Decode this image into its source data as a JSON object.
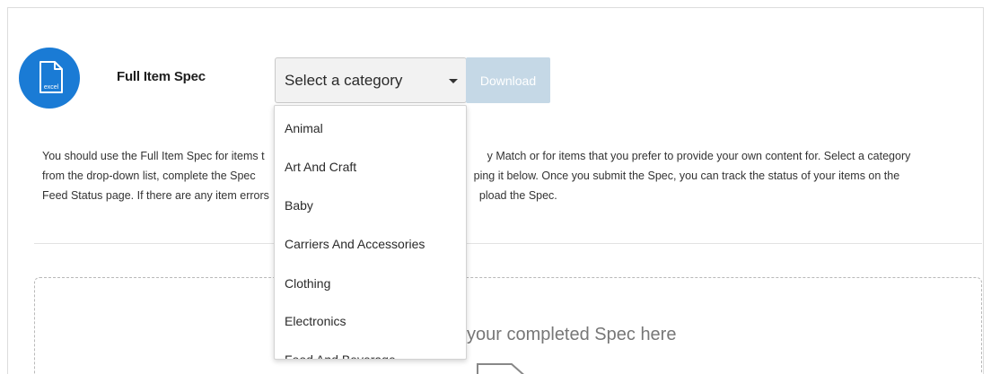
{
  "spec": {
    "title": "Full Item Spec",
    "icon": "excel-file-icon",
    "icon_text": "excel",
    "accent_color": "#1a7bd5"
  },
  "category_select": {
    "selected": "Select a category",
    "options": [
      "Animal",
      "Art And Craft",
      "Baby",
      "Carriers And Accessories",
      "Clothing",
      "Electronics",
      "Food And Beverage"
    ]
  },
  "download": {
    "label": "Download",
    "color": "#c5d8e6"
  },
  "description": {
    "line1": "You should use the Full Item Spec for items t",
    "line1b": "y Match or for items that you prefer to provide your own content for. Select a category",
    "line2": "from the drop-down list, complete the Spec",
    "line2b": "ping it below. Once you submit the Spec, you can track the status of your items on the",
    "line3": "Feed Status page. If there are any item errors",
    "line3b": "pload the Spec."
  },
  "dropzone": {
    "text": "your completed Spec here",
    "icon": "file-upload-icon"
  }
}
